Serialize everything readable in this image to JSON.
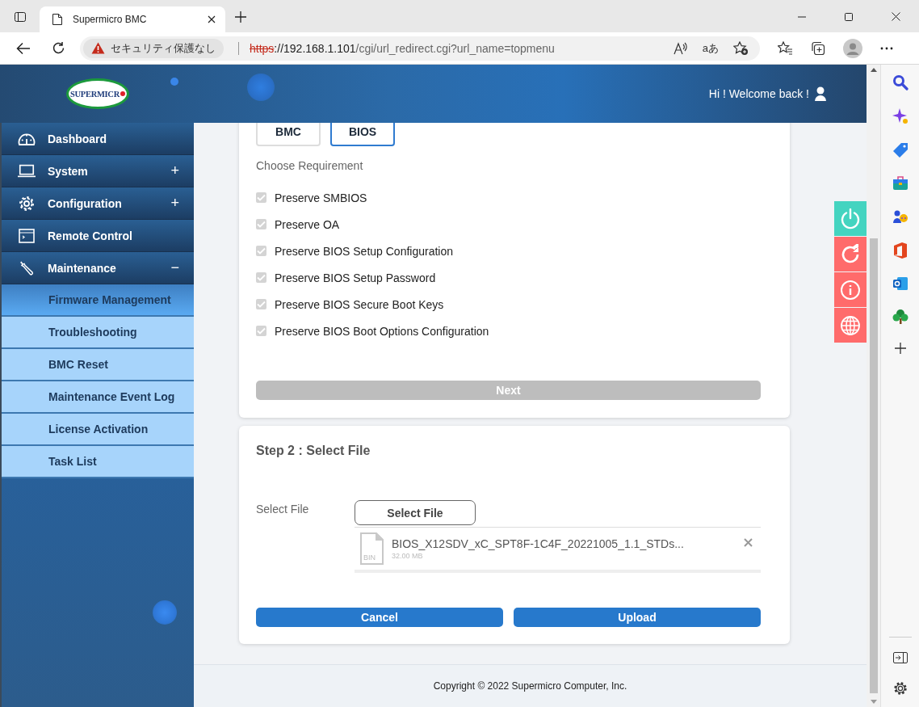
{
  "browser": {
    "tab": {
      "title": "Supermicro BMC"
    },
    "address_bar": {
      "security_label": "セキュリティ保護なし",
      "url_scheme": "https",
      "url_host": "://192.168.1.101",
      "url_path": "/cgi/url_redirect.cgi?url_name=topmenu",
      "translate_label": "aあ"
    }
  },
  "header": {
    "logo": "SUPERMICR",
    "greeting": "Hi ! Welcome back !"
  },
  "nav": [
    {
      "label": "Dashboard",
      "kind": "gauge"
    },
    {
      "label": "System",
      "kind": "laptop",
      "expander": "+"
    },
    {
      "label": "Configuration",
      "kind": "gear",
      "expander": "+"
    },
    {
      "label": "Remote Control",
      "kind": "console"
    },
    {
      "label": "Maintenance",
      "kind": "wrench",
      "expander": "−",
      "children": [
        {
          "label": "Firmware Management",
          "selected": true
        },
        {
          "label": "Troubleshooting",
          "selected": false
        },
        {
          "label": "BMC Reset",
          "selected": false
        },
        {
          "label": "Maintenance Event Log",
          "selected": false
        },
        {
          "label": "License Activation",
          "selected": false
        },
        {
          "label": "Task List",
          "selected": false
        }
      ]
    }
  ],
  "step1": {
    "targets": [
      {
        "label": "BMC",
        "selected": false
      },
      {
        "label": "BIOS",
        "selected": true
      }
    ],
    "heading": "Choose Requirement",
    "options": [
      {
        "label": "Preserve SMBIOS",
        "checked": true,
        "disabled": true
      },
      {
        "label": "Preserve OA",
        "checked": true,
        "disabled": true
      },
      {
        "label": "Preserve BIOS Setup Configuration",
        "checked": true,
        "disabled": true
      },
      {
        "label": "Preserve BIOS Setup Password",
        "checked": true,
        "disabled": true
      },
      {
        "label": "Preserve BIOS Secure Boot Keys",
        "checked": true,
        "disabled": true
      },
      {
        "label": "Preserve BIOS Boot Options Configuration",
        "checked": true,
        "disabled": true
      }
    ],
    "next_button": {
      "label": "Next",
      "disabled": true
    }
  },
  "step2": {
    "title": "Step 2 : Select File",
    "field_label": "Select File",
    "select_button": "Select File",
    "file": {
      "type": "BIN",
      "name": "BIOS_X12SDV_xC_SPT8F-1C4F_20221005_1.1_STDs...",
      "size": "32.00 MB"
    },
    "buttons": [
      "Cancel",
      "Upload"
    ]
  },
  "quick_actions": [
    {
      "kind": "power",
      "color": "#44d4c0"
    },
    {
      "kind": "refresh",
      "color": "#ff6b6b"
    },
    {
      "kind": "info",
      "color": "#ff6b6b"
    },
    {
      "kind": "globe",
      "color": "#ff6b6b"
    }
  ],
  "footer": "Copyright © 2022 Supermicro Computer, Inc."
}
